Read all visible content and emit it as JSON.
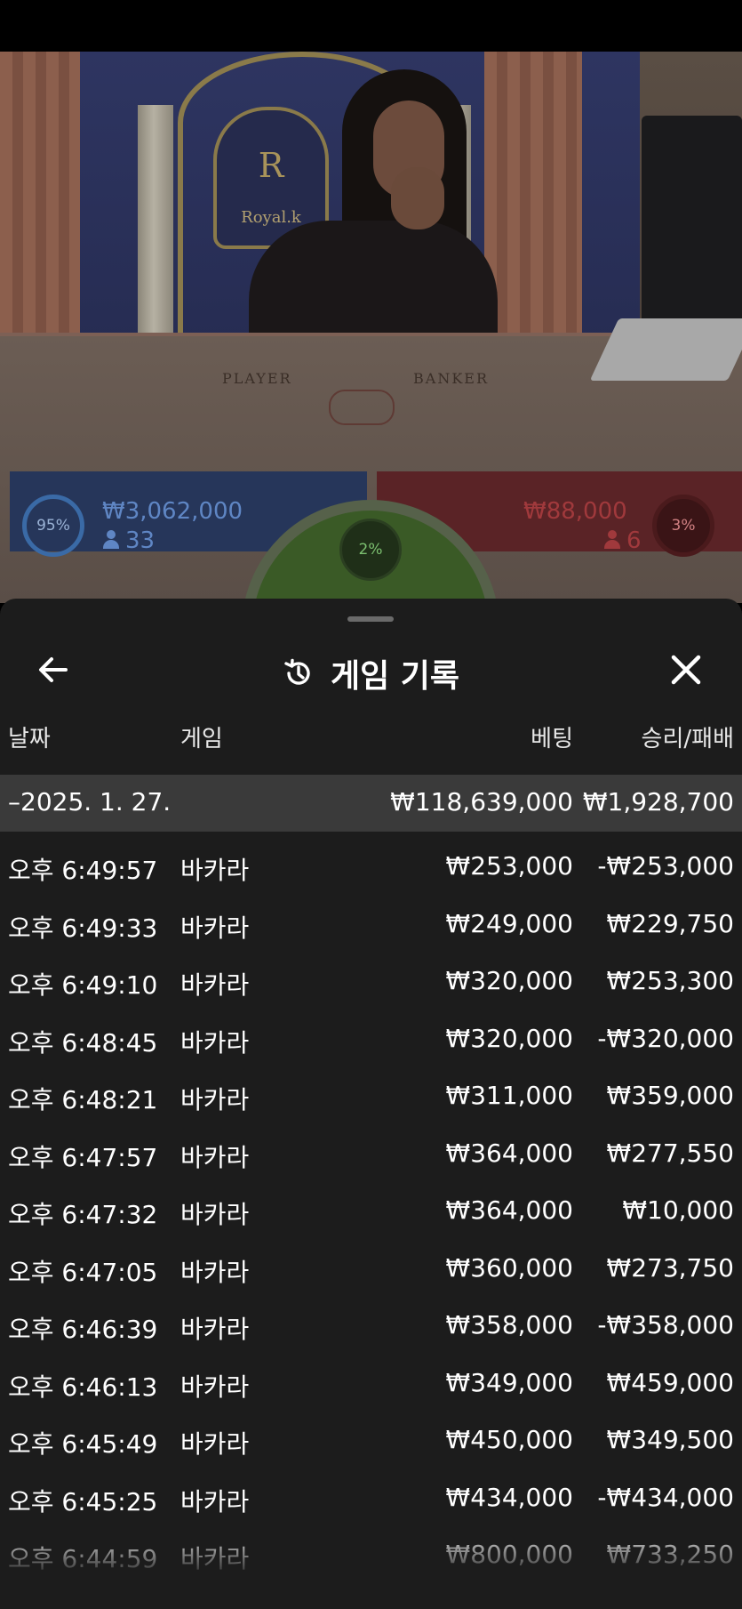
{
  "scene": {
    "emblem_letter": "R",
    "emblem_name": "Royal.k",
    "felt_player": "PLAYER",
    "felt_banker": "BANKER"
  },
  "bets": {
    "player": {
      "percent": "95%",
      "amount": "₩3,062,000",
      "count": "33",
      "color": "#3a6aa6"
    },
    "banker": {
      "percent": "3%",
      "amount": "₩88,000",
      "count": "6",
      "color": "#a0393c"
    },
    "tie": {
      "percent": "2%",
      "color": "#3a5a26"
    }
  },
  "history": {
    "title": "게임 기록",
    "icons": {
      "back": "arrow-left-icon",
      "history": "history-clock-icon",
      "close": "close-icon"
    },
    "columns": {
      "date": "날짜",
      "game": "게임",
      "bet": "베팅",
      "result": "승리/패배"
    },
    "group": {
      "date": "–2025. 1. 27.",
      "bet": "₩118,639,000",
      "result": "₩1,928,700"
    },
    "rows": [
      {
        "time": "오후 6:49:57",
        "game": "바카라",
        "bet": "₩253,000",
        "result": "-₩253,000"
      },
      {
        "time": "오후 6:49:33",
        "game": "바카라",
        "bet": "₩249,000",
        "result": "₩229,750"
      },
      {
        "time": "오후 6:49:10",
        "game": "바카라",
        "bet": "₩320,000",
        "result": "₩253,300"
      },
      {
        "time": "오후 6:48:45",
        "game": "바카라",
        "bet": "₩320,000",
        "result": "-₩320,000"
      },
      {
        "time": "오후 6:48:21",
        "game": "바카라",
        "bet": "₩311,000",
        "result": "₩359,000"
      },
      {
        "time": "오후 6:47:57",
        "game": "바카라",
        "bet": "₩364,000",
        "result": "₩277,550"
      },
      {
        "time": "오후 6:47:32",
        "game": "바카라",
        "bet": "₩364,000",
        "result": "₩10,000"
      },
      {
        "time": "오후 6:47:05",
        "game": "바카라",
        "bet": "₩360,000",
        "result": "₩273,750"
      },
      {
        "time": "오후 6:46:39",
        "game": "바카라",
        "bet": "₩358,000",
        "result": "-₩358,000"
      },
      {
        "time": "오후 6:46:13",
        "game": "바카라",
        "bet": "₩349,000",
        "result": "₩459,000"
      },
      {
        "time": "오후 6:45:49",
        "game": "바카라",
        "bet": "₩450,000",
        "result": "₩349,500"
      },
      {
        "time": "오후 6:45:25",
        "game": "바카라",
        "bet": "₩434,000",
        "result": "-₩434,000"
      },
      {
        "time": "오후 6:44:59",
        "game": "바카라",
        "bet": "₩800,000",
        "result": "₩733,250"
      }
    ]
  }
}
